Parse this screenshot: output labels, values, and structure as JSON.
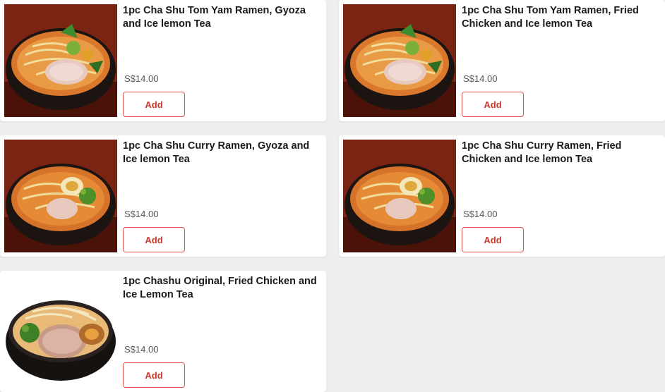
{
  "colors": {
    "page_background": "#eeeeee",
    "card_background": "#ffffff",
    "accent": "#c8382f"
  },
  "menu_items": [
    {
      "name": "1pc Cha Shu Tom Yam Ramen, Gyoza and Ice lemon Tea",
      "price": "S$14.00",
      "add_label": "Add",
      "photo_icon": "tom-yam-ramen-photo"
    },
    {
      "name": "1pc Cha Shu Tom Yam Ramen, Fried Chicken and Ice lemon Tea",
      "price": "S$14.00",
      "add_label": "Add",
      "photo_icon": "tom-yam-ramen-photo"
    },
    {
      "name": "1pc Cha Shu Curry Ramen, Gyoza and Ice lemon Tea",
      "price": "S$14.00",
      "add_label": "Add",
      "photo_icon": "curry-ramen-photo"
    },
    {
      "name": "1pc Cha Shu Curry Ramen, Fried Chicken and Ice lemon Tea",
      "price": "S$14.00",
      "add_label": "Add",
      "photo_icon": "curry-ramen-photo"
    },
    {
      "name": "1pc Chashu Original, Fried Chicken and Ice Lemon Tea",
      "price": "S$14.00",
      "add_label": "Add",
      "photo_icon": "original-ramen-photo"
    }
  ]
}
